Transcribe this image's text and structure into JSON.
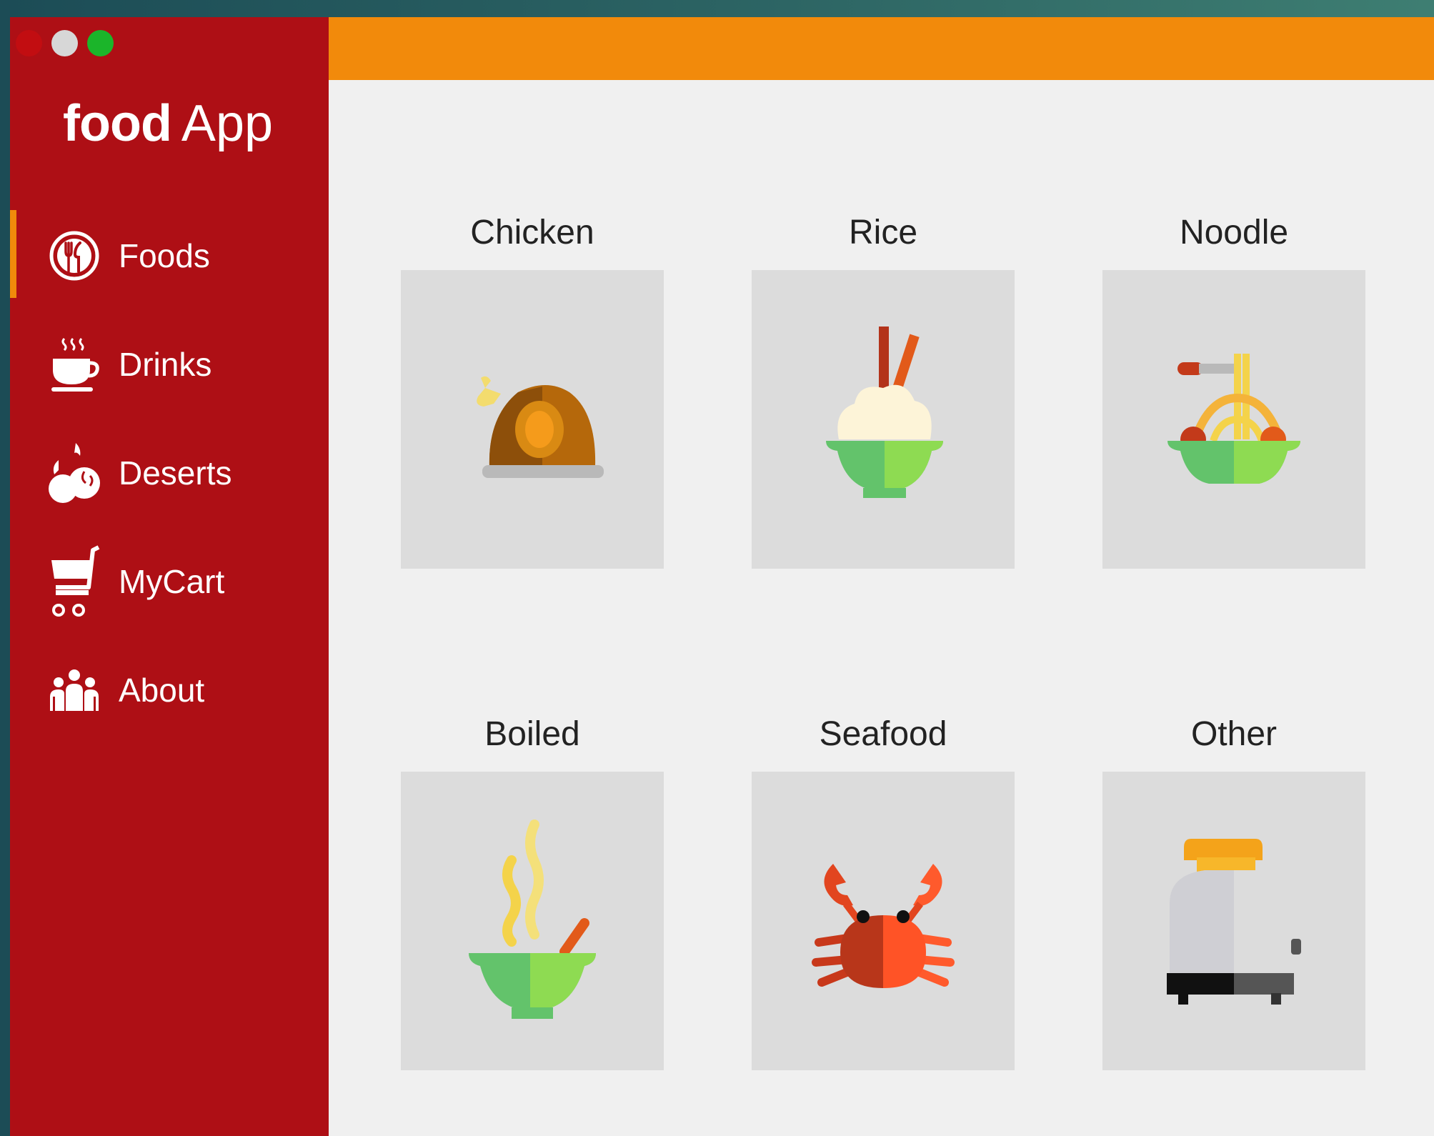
{
  "window": {
    "controls": [
      "close",
      "minimize",
      "maximize"
    ]
  },
  "app": {
    "logo_bold": "food",
    "logo_regular": "App"
  },
  "sidebar": {
    "active_index": 0,
    "accent_color": "#f08a0b",
    "background_color": "#ae0f15",
    "items": [
      {
        "label": "Foods",
        "icon": "plate-fork-icon"
      },
      {
        "label": "Drinks",
        "icon": "coffee-cup-icon"
      },
      {
        "label": "Deserts",
        "icon": "dessert-icon"
      },
      {
        "label": "MyCart",
        "icon": "shopping-cart-icon"
      },
      {
        "label": "About",
        "icon": "people-icon"
      }
    ]
  },
  "topbar": {
    "color": "#f28a0b"
  },
  "categories": [
    {
      "label": "Chicken",
      "icon": "roast-chicken-icon"
    },
    {
      "label": "Rice",
      "icon": "rice-bowl-icon"
    },
    {
      "label": "Noodle",
      "icon": "noodle-bowl-icon"
    },
    {
      "label": "Boiled",
      "icon": "soup-bowl-icon"
    },
    {
      "label": "Seafood",
      "icon": "crab-icon"
    },
    {
      "label": "Other",
      "icon": "toaster-icon"
    }
  ]
}
